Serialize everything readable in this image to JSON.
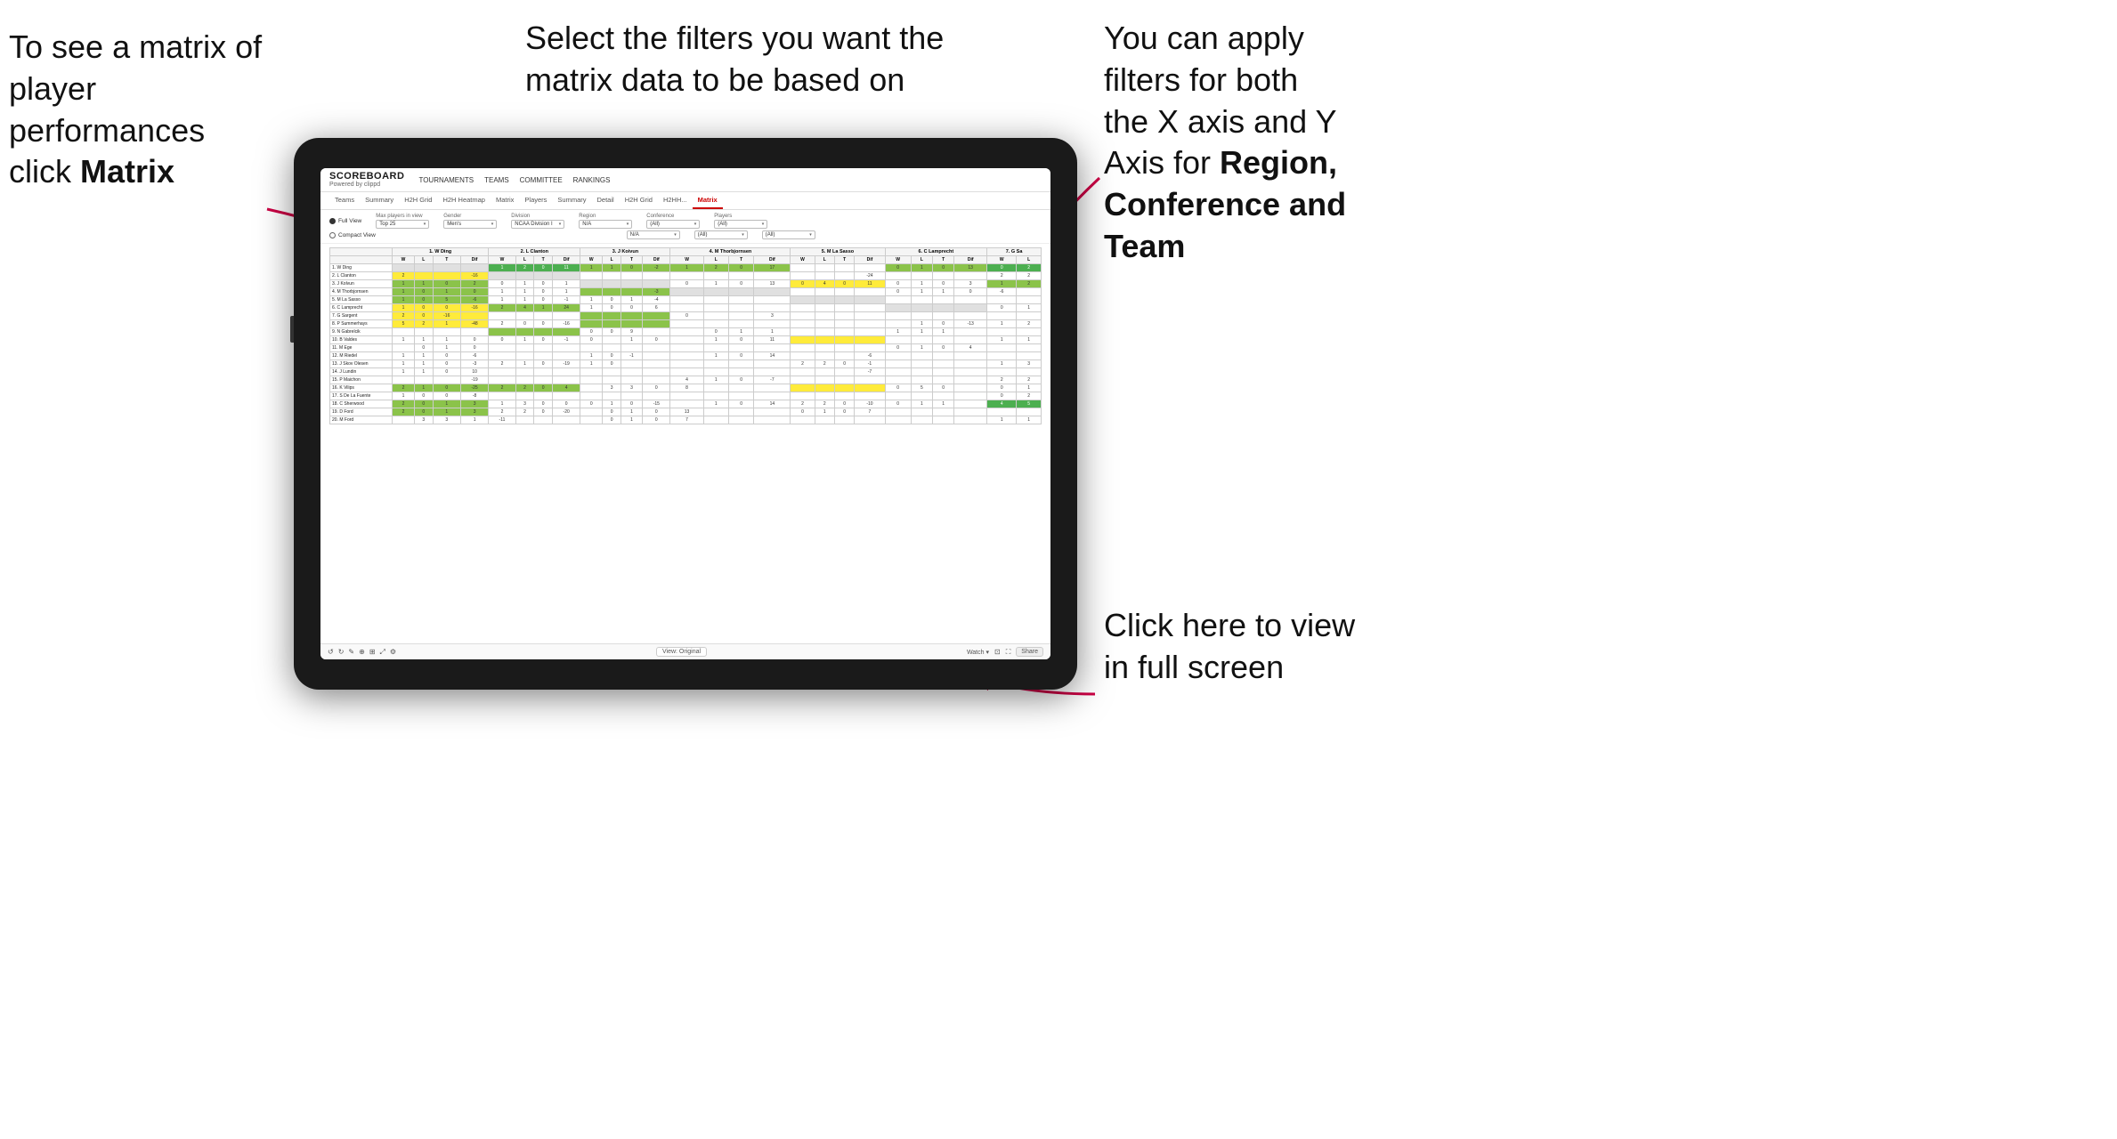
{
  "annotations": {
    "top_left": {
      "line1": "To see a matrix of",
      "line2": "player performances",
      "line3_prefix": "click ",
      "line3_bold": "Matrix"
    },
    "top_center": {
      "line1": "Select the filters you want the",
      "line2": "matrix data to be based on"
    },
    "top_right": {
      "line1": "You  can apply",
      "line2": "filters for both",
      "line3": "the X axis and Y",
      "line4_prefix": "Axis for ",
      "line4_bold": "Region,",
      "line5_bold": "Conference and",
      "line6_bold": "Team"
    },
    "bottom_right": {
      "line1": "Click here to view",
      "line2": "in full screen"
    }
  },
  "tablet": {
    "header": {
      "logo_main": "SCOREBOARD",
      "logo_sub": "Powered by clippd",
      "nav_items": [
        "TOURNAMENTS",
        "TEAMS",
        "COMMITTEE",
        "RANKINGS"
      ]
    },
    "tabs": {
      "items": [
        "Teams",
        "Summary",
        "H2H Grid",
        "H2H Heatmap",
        "Matrix",
        "Players",
        "Summary",
        "Detail",
        "H2H Grid",
        "H2HH...",
        "Matrix"
      ],
      "active_index": 10
    },
    "filters": {
      "view_options": [
        "Full View",
        "Compact View"
      ],
      "selected_view": "Full View",
      "max_players_label": "Max players in view",
      "max_players_value": "Top 25",
      "gender_label": "Gender",
      "gender_value": "Men's",
      "division_label": "Division",
      "division_value": "NCAA Division I",
      "region_label": "Region",
      "region_value": "N/A",
      "conference_label": "Conference",
      "conference_value": "(All)",
      "conference_value2": "(All)",
      "players_label": "Players",
      "players_value": "(All)",
      "players_value2": "(All)"
    },
    "matrix": {
      "col_headers": [
        "1. W Ding",
        "2. L Clanton",
        "3. J Koivun",
        "4. M Thorbjornsen",
        "5. M La Sasso",
        "6. C Lamprecht",
        "7. G Sa"
      ],
      "row_headers": [
        "1. W Ding",
        "2. L Clanton",
        "3. J Kolvun",
        "4. M Thorbjornsen",
        "5. M La Sasso",
        "6. C Lamprecht",
        "7. G Sargent",
        "8. P Summerhays",
        "9. N Gabrelcik",
        "10. B Valdes",
        "11. M Ege",
        "12. M Riedel",
        "13. J Skov Olesen",
        "14. J Lundin",
        "15. P Maichon",
        "16. K Vilips",
        "17. S De La Fuente",
        "18. C Sherwood",
        "19. D Ford",
        "20. M Ford"
      ]
    },
    "toolbar": {
      "view_original": "View: Original",
      "watch_label": "Watch ▾",
      "share_label": "Share"
    }
  }
}
